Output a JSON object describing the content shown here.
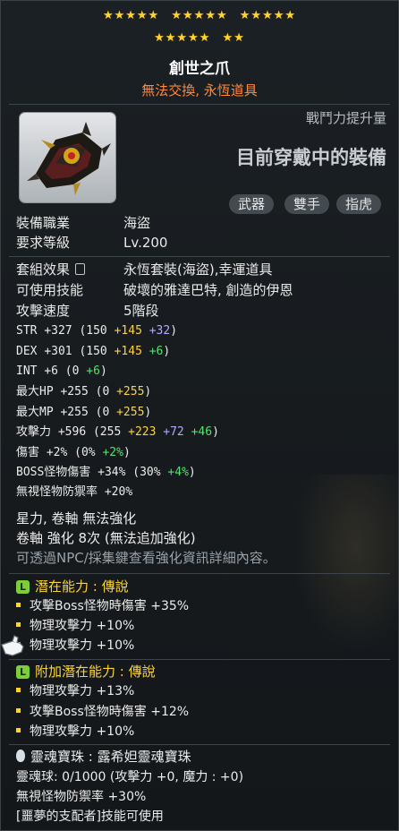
{
  "stars": {
    "row1": [
      "★★★★★",
      "★★★★★",
      "★★★★★"
    ],
    "row2": [
      "★★★★★",
      "★★"
    ]
  },
  "item": {
    "name": "創世之爪",
    "trade": "無法交換, 永恆道具",
    "icon": "claw-weapon-icon"
  },
  "combat": {
    "label": "戰鬥力提升量",
    "value": "目前穿戴中的裝備"
  },
  "tags": [
    "武器",
    "雙手",
    "指虎"
  ],
  "requirements": [
    {
      "label": "裝備職業",
      "value": "海盜"
    },
    {
      "label": "要求等級",
      "value": "Lv.200"
    }
  ],
  "info": [
    {
      "label": "套組效果",
      "value": "永恆套裝(海盜),幸運道具"
    },
    {
      "label": "可使用技能",
      "value": "破壞的雅達巴特, 創造的伊恩"
    },
    {
      "label": "攻擊速度",
      "value": "5階段"
    }
  ],
  "stats": [
    {
      "n": "STR",
      "t": "+327",
      "b": "(150",
      "f": "+145",
      "s": "+32",
      "e": ")"
    },
    {
      "n": "DEX",
      "t": "+301",
      "b": "(150",
      "f": "+145",
      "s": "",
      "g": "+6",
      "e": ")"
    },
    {
      "n": "INT",
      "t": "+6",
      "b": "(0",
      "f": "",
      "s": "",
      "g": "+6",
      "e": ")"
    },
    {
      "n": "最大HP",
      "t": "+255",
      "b": "(0",
      "f": "+255",
      "s": "",
      "g": "",
      "e": ")"
    },
    {
      "n": "最大MP",
      "t": "+255",
      "b": "(0",
      "f": "+255",
      "s": "",
      "g": "",
      "e": ")"
    },
    {
      "n": "攻擊力",
      "t": "+596",
      "b": "(255",
      "f": "+223",
      "s": "+72",
      "g": "+46",
      "e": ")"
    },
    {
      "n": "傷害",
      "t": "+2%",
      "b": "(0%",
      "f": "",
      "s": "",
      "g": "+2%",
      "e": ")"
    },
    {
      "n": "BOSS怪物傷害",
      "t": "+34%",
      "b": "(30%",
      "f": "",
      "s": "",
      "g": "+4%",
      "e": ")"
    },
    {
      "n": "無視怪物防禦率",
      "t": "+20%",
      "b": "",
      "f": "",
      "s": "",
      "g": "",
      "e": ""
    }
  ],
  "enhance": {
    "star_force": "星力, 卷軸 無法強化",
    "scroll": "卷軸 強化 8次 (無法追加強化)",
    "hint": "可透過NPC/採集鍵查看強化資訊詳細內容。"
  },
  "potential": {
    "badge": "L",
    "title": "潛在能力 : 傳說",
    "lines": [
      "攻擊Boss怪物時傷害 +35%",
      "物理攻擊力 +10%",
      "物理攻擊力 +10%"
    ]
  },
  "additional": {
    "badge": "L",
    "title": "附加潛在能力 : 傳說",
    "lines": [
      "物理攻擊力 +13%",
      "攻擊Boss怪物時傷害 +12%",
      "物理攻擊力 +10%"
    ]
  },
  "soul": {
    "title": "靈魂寶珠 : 露希妲靈魂寶珠",
    "orb": "靈魂球: 0/1000 (攻擊力 +0, 魔力 : +0)",
    "ignore_def": "無視怪物防禦率 +30%",
    "skill": "[噩夢的支配者]技能可使用"
  }
}
